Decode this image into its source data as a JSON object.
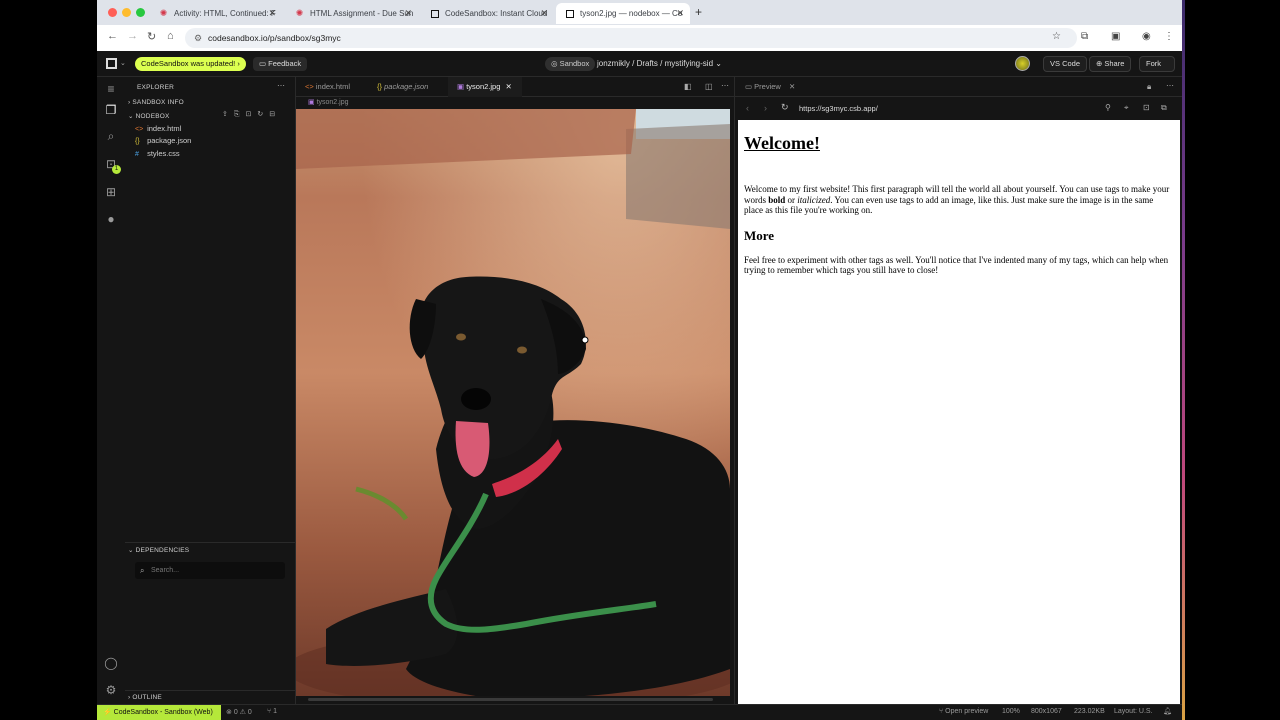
{
  "browser_tabs": [
    {
      "title": "Activity: HTML, Continued: F",
      "favicon": "canvas-icon"
    },
    {
      "title": "HTML Assignment - Due Sun",
      "favicon": "canvas-icon"
    },
    {
      "title": "CodeSandbox: Instant Cloud",
      "favicon": "codesandbox-icon"
    },
    {
      "title": "tyson2.jpg — nodebox — Co",
      "favicon": "codesandbox-icon"
    }
  ],
  "address": {
    "url": "codesandbox.io/p/sandbox/sg3myc"
  },
  "csb": {
    "updated": "CodeSandbox was updated!",
    "feedback": "Feedback",
    "sandbox_chip": "Sandbox",
    "breadcrumb": "jonzmikly  /  Drafts  /  mystifying-sid",
    "vscode": "VS Code",
    "share": "Share",
    "fork": "Fork"
  },
  "sidebar": {
    "explorer": "EXPLORER",
    "sandbox_info": "SANDBOX INFO",
    "nodebox": "NODEBOX",
    "files": [
      {
        "name": "index.html",
        "icon": "<>",
        "color": "#e37933"
      },
      {
        "name": "package.json",
        "icon": "{}",
        "color": "#d6c13a"
      },
      {
        "name": "styles.css",
        "icon": "#",
        "color": "#4aa0e0"
      }
    ],
    "dependencies": "DEPENDENCIES",
    "search_placeholder": "Search...",
    "outline": "OUTLINE",
    "activity_badge": "1"
  },
  "editor": {
    "tabs": [
      {
        "label": "index.html",
        "icon": "<>",
        "color": "#e37933",
        "italic": false,
        "active": false
      },
      {
        "label": "package.json",
        "icon": "{}",
        "color": "#d6c13a",
        "italic": true,
        "active": false
      },
      {
        "label": "tyson2.jpg",
        "icon": "img",
        "color": "#b07adf",
        "italic": false,
        "active": true
      }
    ],
    "breadcrumb": "tyson2.jpg"
  },
  "preview": {
    "tab_label": "Preview",
    "url": "https://sg3myc.csb.app/",
    "heading": "Welcome!",
    "p1_start": "Welcome to my first website! This first paragraph will tell the world all about yourself. You can use tags to make your words ",
    "p1_bold": "bold",
    "p1_mid": " or ",
    "p1_italic": "italicized",
    "p1_end": ". You can even use tags to add an image, like this. Just make sure the image is in the same place as this file you're working on.",
    "subheading": "More",
    "p2": "Feel free to experiment with other tags as well. You'll notice that I've indented many of my tags, which can help when trying to remember which tags you still have to close!"
  },
  "status": {
    "brand": "CodeSandbox - Sandbox (Web)",
    "problems": "0 ⚠ 0",
    "ports": "1",
    "open_preview": "Open preview",
    "zoom": "100%",
    "dimensions": "800x1067",
    "filesize": "223.02KB",
    "layout": "Layout: U.S."
  }
}
